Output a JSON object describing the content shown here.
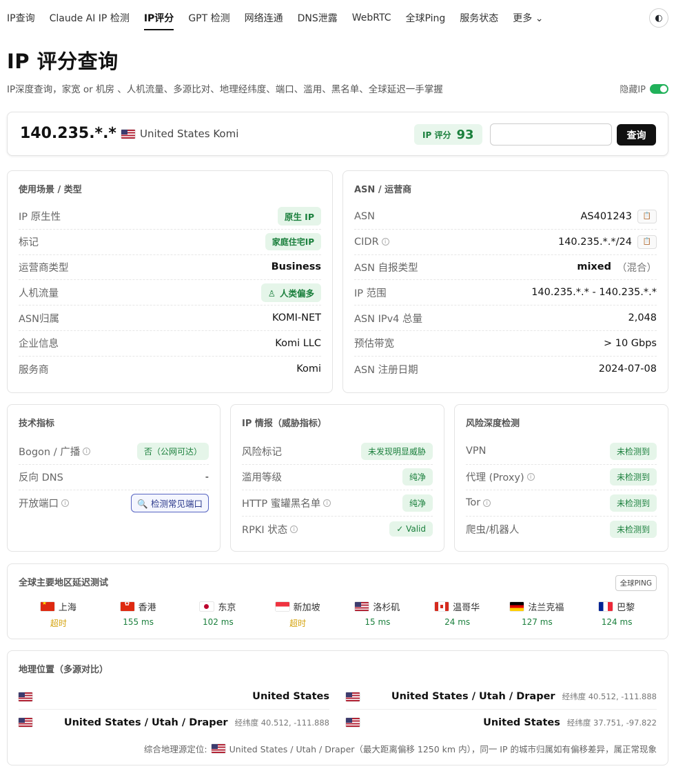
{
  "nav": {
    "items": [
      "IP查询",
      "Claude AI IP 检测",
      "IP评分",
      "GPT 检测",
      "网络连通",
      "DNS泄露",
      "WebRTC",
      "全球Ping",
      "服务状态",
      "更多"
    ],
    "more_chevron": "⌄",
    "theme_icon": "◐"
  },
  "header": {
    "title": "IP 评分查询",
    "subtitle": "IP深度查询，家宽 or 机房 、人机流量、多源比对、地理经纬度、端口、滥用、黑名单、全球延迟一手掌握",
    "hide_ip_label": "隐藏IP",
    "hide_ip_on": true
  },
  "search": {
    "ip": "140.235.*.*",
    "location": "United States Komi",
    "score_label": "IP 评分",
    "score": "93",
    "input_value": "",
    "button": "查询"
  },
  "usage": {
    "title": "使用场景 / 类型",
    "rows": [
      {
        "k": "IP 原生性",
        "v": "原生 IP"
      },
      {
        "k": "标记",
        "v": "家庭住宅IP"
      },
      {
        "k": "运营商类型",
        "v": "Business"
      },
      {
        "k": "人机流量",
        "v": "人类偏多"
      },
      {
        "k": "ASN归属",
        "v": "KOMI-NET"
      },
      {
        "k": "企业信息",
        "v": "Komi LLC"
      },
      {
        "k": "服务商",
        "v": "Komi"
      }
    ]
  },
  "asn": {
    "title": "ASN / 运营商",
    "rows": [
      {
        "k": "ASN",
        "v": "AS401243"
      },
      {
        "k": "CIDR",
        "v": "140.235.*.*/24"
      },
      {
        "k": "ASN 自报类型",
        "v": "mixed",
        "v2": "（混合）"
      },
      {
        "k": "IP 范围",
        "v": "140.235.*.* - 140.235.*.*"
      },
      {
        "k": "ASN IPv4 总量",
        "v": "2,048"
      },
      {
        "k": "预估带宽",
        "v": "> 10 Gbps"
      },
      {
        "k": "ASN 注册日期",
        "v": "2024-07-08"
      }
    ]
  },
  "tech": {
    "title": "技术指标",
    "rows": [
      {
        "k": "Bogon / 广播",
        "v": "否（公网可达）"
      },
      {
        "k": "反向 DNS",
        "v": "-"
      },
      {
        "k": "开放端口",
        "v": "检测常见端口"
      }
    ]
  },
  "intel": {
    "title": "IP 情报（威胁指标）",
    "rows": [
      {
        "k": "风险标记",
        "v": "未发现明显威胁"
      },
      {
        "k": "滥用等级",
        "v": "纯净"
      },
      {
        "k": "HTTP 蜜罐黑名单",
        "v": "纯净"
      },
      {
        "k": "RPKI 状态",
        "v": "✓ Valid"
      }
    ]
  },
  "risk": {
    "title": "风险深度检测",
    "rows": [
      {
        "k": "VPN",
        "v": "未检测到"
      },
      {
        "k": "代理 (Proxy)",
        "v": "未检测到"
      },
      {
        "k": "Tor",
        "v": "未检测到"
      },
      {
        "k": "爬虫/机器人",
        "v": "未检测到"
      }
    ]
  },
  "latency": {
    "title": "全球主要地区延迟测试",
    "button": "全球PING",
    "colors": {
      "ok": "#1a7f3c",
      "timeout": "#d4a20c"
    },
    "items": [
      {
        "city": "上海",
        "flag": "cn",
        "value": "超时",
        "status": "warn"
      },
      {
        "city": "香港",
        "flag": "hk",
        "value": "155 ms",
        "status": "ok"
      },
      {
        "city": "东京",
        "flag": "jp",
        "value": "102 ms",
        "status": "ok"
      },
      {
        "city": "新加坡",
        "flag": "sg",
        "value": "超时",
        "status": "warn"
      },
      {
        "city": "洛杉矶",
        "flag": "us",
        "value": "15 ms",
        "status": "ok"
      },
      {
        "city": "温哥华",
        "flag": "ca",
        "value": "24 ms",
        "status": "ok"
      },
      {
        "city": "法兰克福",
        "flag": "de",
        "value": "127 ms",
        "status": "ok"
      },
      {
        "city": "巴黎",
        "flag": "fr",
        "value": "124 ms",
        "status": "ok"
      }
    ]
  },
  "geo": {
    "title": "地理位置（多源对比）",
    "left": [
      {
        "place": "United States",
        "coord": ""
      },
      {
        "place": "United States / Utah / Draper",
        "coord": "经纬度 40.512, -111.888"
      }
    ],
    "right": [
      {
        "place": "United States / Utah / Draper",
        "coord": "经纬度 40.512, -111.888"
      },
      {
        "place": "United States",
        "coord": "经纬度 37.751, -97.822"
      }
    ],
    "summary_prefix": "综合地理源定位:",
    "summary": "United States / Utah / Draper（最大距离偏移 1250 km 内），同一 IP 的城市归属如有偏移差异，属正常现象"
  }
}
